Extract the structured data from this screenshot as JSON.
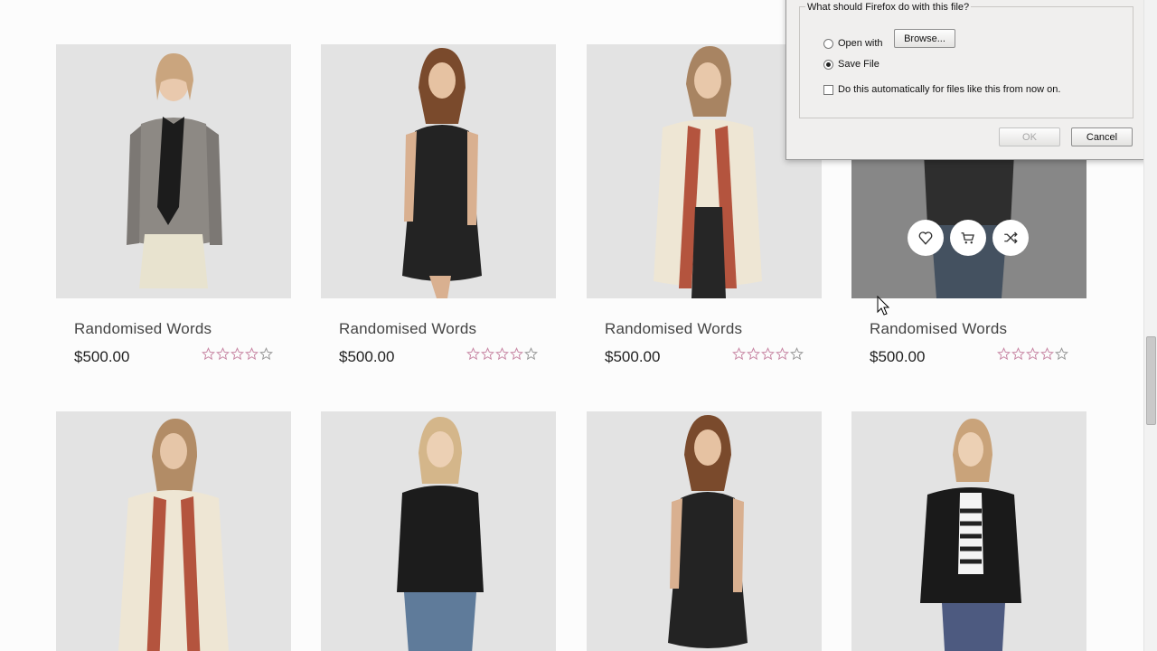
{
  "products": [
    {
      "name": "Randomised Words",
      "price": "$500.00",
      "rating_filled": 4,
      "rating_max": 5
    },
    {
      "name": "Randomised Words",
      "price": "$500.00",
      "rating_filled": 4,
      "rating_max": 5
    },
    {
      "name": "Randomised Words",
      "price": "$500.00",
      "rating_filled": 4,
      "rating_max": 5
    },
    {
      "name": "Randomised Words",
      "price": "$500.00",
      "rating_filled": 4,
      "rating_max": 5
    },
    {
      "name": "",
      "price": "",
      "rating_filled": 0,
      "rating_max": 5
    },
    {
      "name": "",
      "price": "",
      "rating_filled": 0,
      "rating_max": 5
    },
    {
      "name": "",
      "price": "",
      "rating_filled": 0,
      "rating_max": 5
    },
    {
      "name": "",
      "price": "",
      "rating_filled": 0,
      "rating_max": 5
    }
  ],
  "hover_actions": [
    "wishlist-icon",
    "cart-icon",
    "shuffle-icon"
  ],
  "dialog": {
    "question": "What should Firefox do with this file?",
    "open_with_label": "Open with",
    "browse_label": "Browse...",
    "save_file_label": "Save File",
    "auto_label": "Do this automatically for files like this from now on.",
    "ok_label": "OK",
    "cancel_label": "Cancel",
    "selected_option": "save_file"
  },
  "colors": {
    "star": "#c98aa6",
    "overlay": "#5a5a5a",
    "photo_bg": "#e3e3e3"
  }
}
